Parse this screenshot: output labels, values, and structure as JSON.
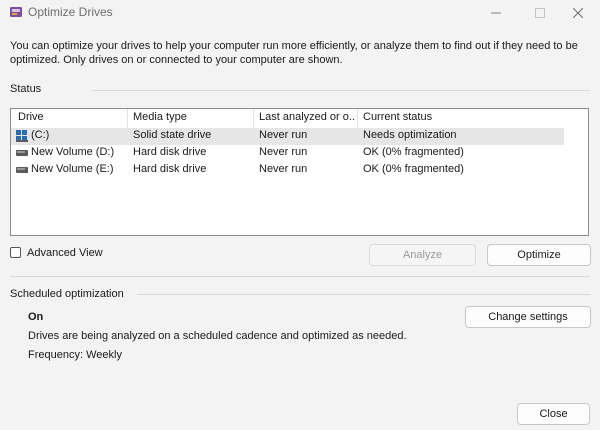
{
  "window": {
    "title": "Optimize Drives",
    "accent": "#0067c0"
  },
  "description": "You can optimize your drives to help your computer run more efficiently, or analyze them to find out if they need to be optimized. Only drives on or connected to your computer are shown.",
  "status_section": {
    "label": "Status",
    "columns": [
      "Drive",
      "Media type",
      "Last analyzed or o...",
      "Current status"
    ],
    "drives": [
      {
        "name": "(C:)",
        "icon": "windows-drive-icon",
        "media_type": "Solid state drive",
        "last_analyzed": "Never run",
        "status": "Needs optimization",
        "selected": true
      },
      {
        "name": "New Volume (D:)",
        "icon": "hard-disk-icon",
        "media_type": "Hard disk drive",
        "last_analyzed": "Never run",
        "status": "OK (0% fragmented)",
        "selected": false
      },
      {
        "name": "New Volume (E:)",
        "icon": "hard-disk-icon",
        "media_type": "Hard disk drive",
        "last_analyzed": "Never run",
        "status": "OK (0% fragmented)",
        "selected": false
      }
    ]
  },
  "advanced_view": {
    "label": "Advanced View",
    "checked": false
  },
  "actions": {
    "analyze": "Analyze",
    "analyze_disabled": true,
    "optimize": "Optimize"
  },
  "scheduled": {
    "label": "Scheduled optimization",
    "state": "On",
    "detail": "Drives are being analyzed on a scheduled cadence and optimized as needed.",
    "frequency": "Frequency: Weekly",
    "change_settings": "Change settings"
  },
  "footer": {
    "close": "Close"
  }
}
